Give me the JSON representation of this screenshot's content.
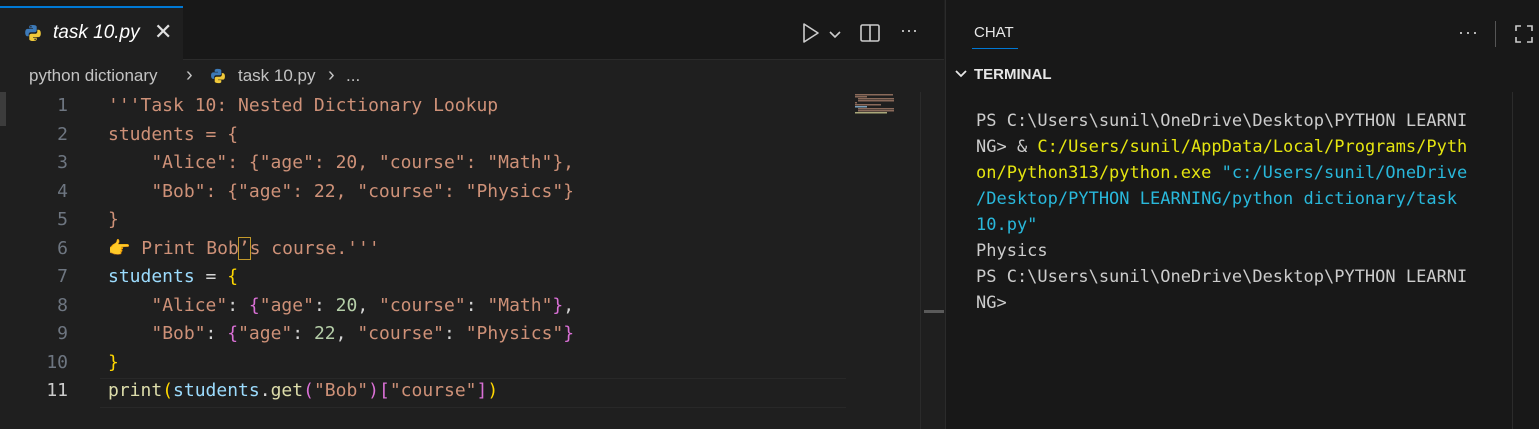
{
  "editor": {
    "tab": {
      "filename": "task 10.py",
      "close": "✕"
    },
    "toolbar": {
      "more": "···"
    },
    "breadcrumb": {
      "folder": "python dictionary",
      "sep1": "›",
      "file": "task 10.py",
      "sep2": "›",
      "ellipsis": "..."
    },
    "lines": [
      {
        "n": "1",
        "tokens": [
          {
            "t": "'''Task 10: Nested Dictionary Lookup",
            "c": "str"
          }
        ]
      },
      {
        "n": "2",
        "tokens": [
          {
            "t": "students = {",
            "c": "str"
          }
        ]
      },
      {
        "n": "3",
        "tokens": [
          {
            "t": "    \"Alice\": {\"age\": 20, \"course\": \"Math\"},",
            "c": "str"
          }
        ]
      },
      {
        "n": "4",
        "tokens": [
          {
            "t": "    \"Bob\": {\"age\": 22, \"course\": \"Physics\"}",
            "c": "str"
          }
        ]
      },
      {
        "n": "5",
        "tokens": [
          {
            "t": "}",
            "c": "str"
          }
        ]
      },
      {
        "n": "6",
        "tokens": [
          {
            "t": "👉 Print Bob",
            "c": "str"
          },
          {
            "t": "’",
            "c": "str hl"
          },
          {
            "t": "s course.'''",
            "c": "str"
          }
        ]
      },
      {
        "n": "7",
        "tokens": [
          {
            "t": "students",
            "c": "var"
          },
          {
            "t": " = ",
            "c": "op"
          },
          {
            "t": "{",
            "c": "b1"
          }
        ]
      },
      {
        "n": "8",
        "tokens": [
          {
            "t": "    ",
            "c": "op"
          },
          {
            "t": "\"Alice\"",
            "c": "str"
          },
          {
            "t": ": ",
            "c": "op"
          },
          {
            "t": "{",
            "c": "b2"
          },
          {
            "t": "\"age\"",
            "c": "str"
          },
          {
            "t": ": ",
            "c": "op"
          },
          {
            "t": "20",
            "c": "num"
          },
          {
            "t": ", ",
            "c": "op"
          },
          {
            "t": "\"course\"",
            "c": "str"
          },
          {
            "t": ": ",
            "c": "op"
          },
          {
            "t": "\"Math\"",
            "c": "str"
          },
          {
            "t": "}",
            "c": "b2"
          },
          {
            "t": ",",
            "c": "op"
          }
        ]
      },
      {
        "n": "9",
        "tokens": [
          {
            "t": "    ",
            "c": "op"
          },
          {
            "t": "\"Bob\"",
            "c": "str"
          },
          {
            "t": ": ",
            "c": "op"
          },
          {
            "t": "{",
            "c": "b2"
          },
          {
            "t": "\"age\"",
            "c": "str"
          },
          {
            "t": ": ",
            "c": "op"
          },
          {
            "t": "22",
            "c": "num"
          },
          {
            "t": ", ",
            "c": "op"
          },
          {
            "t": "\"course\"",
            "c": "str"
          },
          {
            "t": ": ",
            "c": "op"
          },
          {
            "t": "\"Physics\"",
            "c": "str"
          },
          {
            "t": "}",
            "c": "b2"
          }
        ]
      },
      {
        "n": "10",
        "tokens": [
          {
            "t": "}",
            "c": "b1"
          }
        ]
      },
      {
        "n": "11",
        "tokens": [
          {
            "t": "print",
            "c": "fn"
          },
          {
            "t": "(",
            "c": "b1"
          },
          {
            "t": "students",
            "c": "var"
          },
          {
            "t": ".",
            "c": "op"
          },
          {
            "t": "get",
            "c": "fn"
          },
          {
            "t": "(",
            "c": "b2"
          },
          {
            "t": "\"Bob\"",
            "c": "str"
          },
          {
            "t": ")",
            "c": "b2"
          },
          {
            "t": "[",
            "c": "b2"
          },
          {
            "t": "\"course\"",
            "c": "str"
          },
          {
            "t": "]",
            "c": "b2"
          },
          {
            "t": ")",
            "c": "b1"
          }
        ]
      }
    ],
    "current_line": "11"
  },
  "panel": {
    "chat_tab": "CHAT",
    "more": "···",
    "terminal_header": "TERMINAL",
    "terminal_lines": [
      [
        {
          "t": "PS C:\\Users\\sunil\\OneDrive\\Desktop\\PYTHON LEARNI",
          "c": ""
        }
      ],
      [
        {
          "t": "NG> & ",
          "c": ""
        },
        {
          "t": "C:/Users/sunil/AppData/Local/Programs/Pyth",
          "c": "t-yellow"
        }
      ],
      [
        {
          "t": "on/Python313/python.exe ",
          "c": "t-yellow"
        },
        {
          "t": "\"c:/Users/sunil/OneDrive",
          "c": "t-blue"
        }
      ],
      [
        {
          "t": "/Desktop/PYTHON LEARNING/python dictionary/task",
          "c": "t-blue"
        }
      ],
      [
        {
          "t": "10.py\"",
          "c": "t-blue"
        }
      ],
      [
        {
          "t": "Physics",
          "c": ""
        }
      ],
      [
        {
          "t": "PS C:\\Users\\sunil\\OneDrive\\Desktop\\PYTHON LEARNI",
          "c": ""
        }
      ],
      [
        {
          "t": "NG>",
          "c": ""
        }
      ]
    ]
  },
  "colors": {
    "accent": "#0078d4",
    "python_blue": "#3d7ab8",
    "python_yellow": "#f0c93a"
  },
  "icons": [
    "python-file-icon",
    "close-icon",
    "run-icon",
    "chevron-down-icon",
    "split-editor-icon",
    "more-actions-icon",
    "chevron-right-icon",
    "maximize-icon"
  ]
}
